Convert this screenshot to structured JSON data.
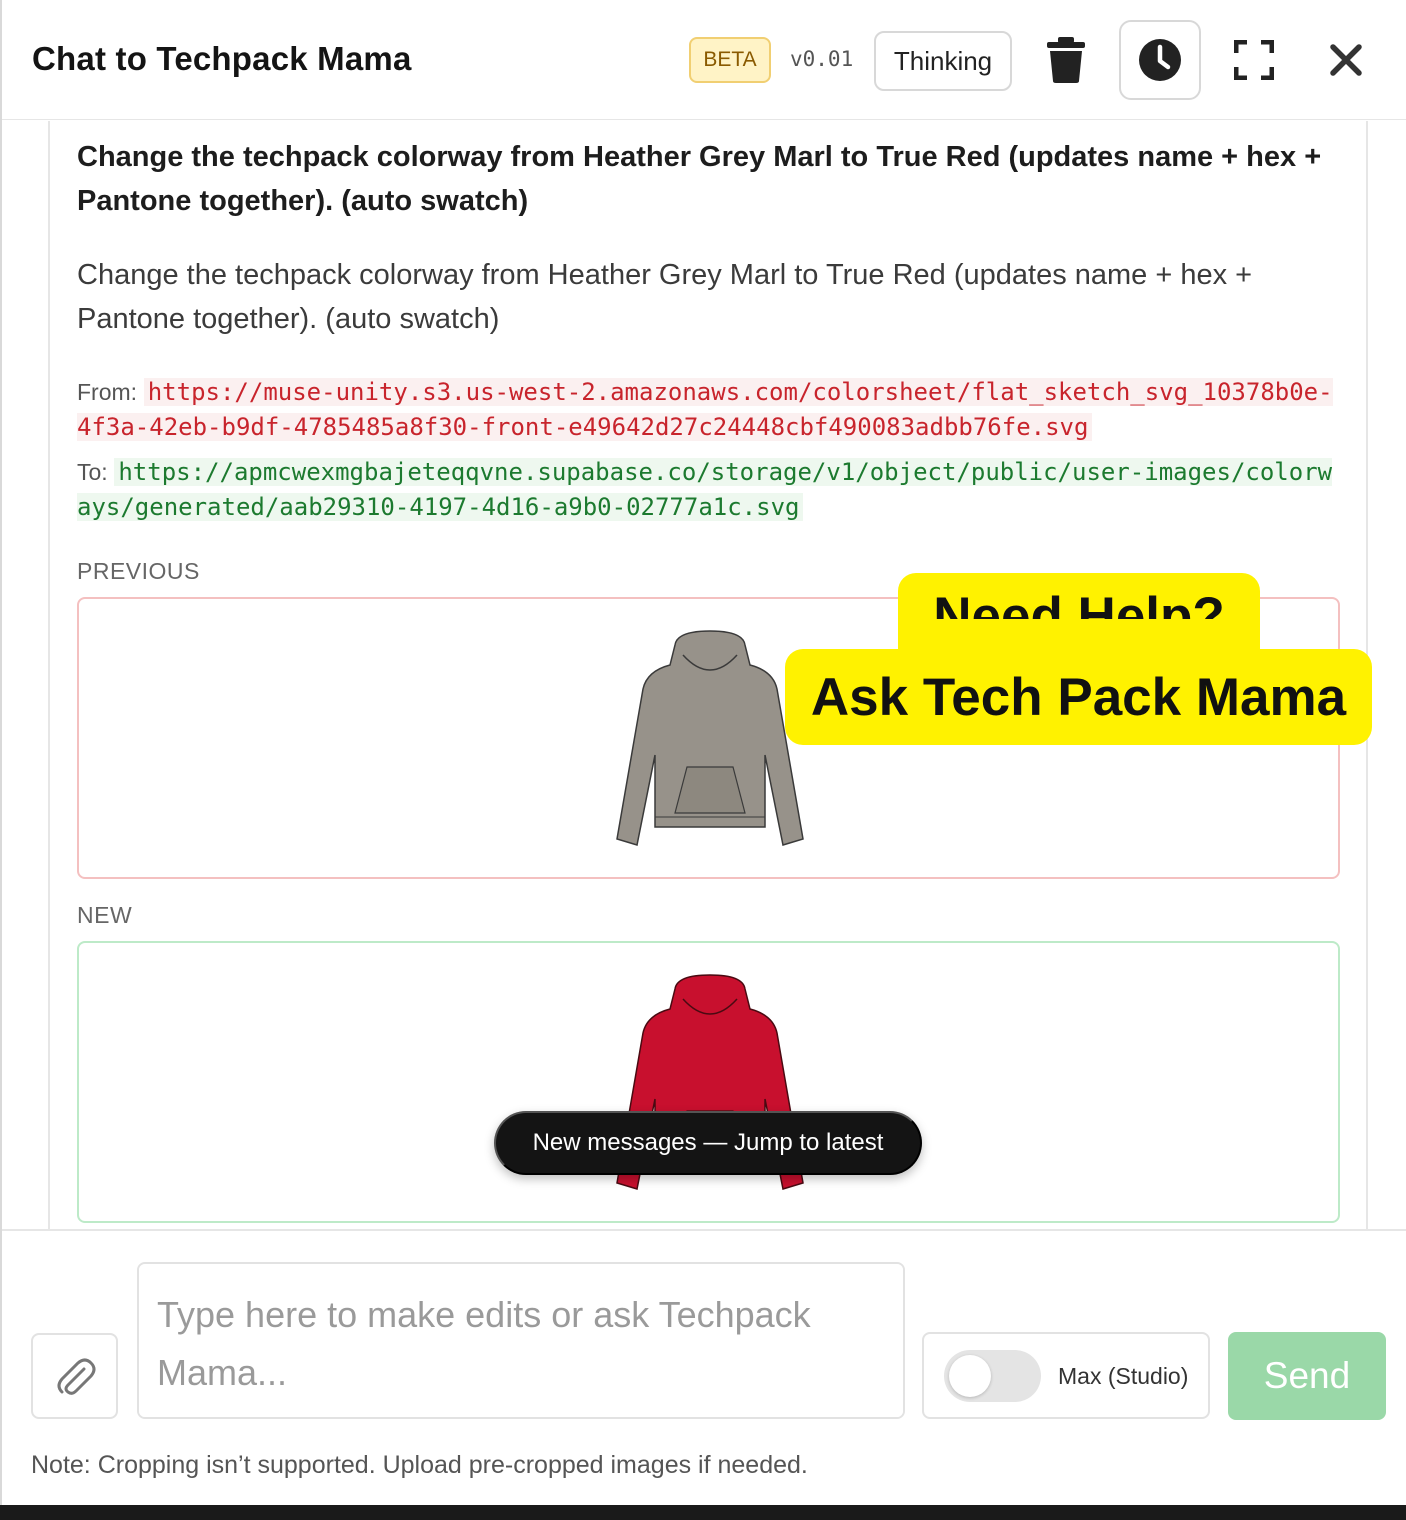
{
  "header": {
    "title": "Chat to Techpack Mama",
    "badge": "BETA",
    "version": "v0.01",
    "thinking_label": "Thinking",
    "icons": [
      "trash-icon",
      "clock-icon",
      "expand-icon",
      "close-icon"
    ]
  },
  "message": {
    "bold_text": "Change the techpack colorway from Heather Grey Marl to True Red (updates name + hex + Pantone together). (auto swatch)",
    "body_text": "Change the techpack colorway from Heather Grey Marl to True Red (updates name + hex + Pantone together). (auto swatch)",
    "from_label": "From:",
    "from_url": "https://muse-unity.s3.us-west-2.amazonaws.com/colorsheet/flat_sketch_svg_10378b0e-4f3a-42eb-b9df-4785485a8f30-front-e49642d27c24448cbf490083adbb76fe.svg",
    "to_label": "To:",
    "to_url": "https://apmcwexmgbajeteqqvne.supabase.co/storage/v1/object/public/user-images/colorways/generated/aab29310-4197-4d16-a9b0-02777a1c.svg",
    "previous_label": "PREVIOUS",
    "new_label": "NEW",
    "previous_color": "#97928a",
    "new_color": "#c8102e"
  },
  "help_overlay": {
    "line1": "Need Help?",
    "line2": "Ask Tech Pack Mama",
    "color": "#fff200"
  },
  "jump_button": "New messages — Jump to latest",
  "composer": {
    "placeholder": "Type here to make edits or ask Techpack Mama...",
    "mode_label": "Max (Studio)",
    "send_label": "Send",
    "note": "Note: Cropping isn’t supported. Upload pre-cropped images if needed."
  },
  "colors": {
    "send_disabled": "#9ad8a8",
    "badge_bg": "#fff3c6"
  }
}
